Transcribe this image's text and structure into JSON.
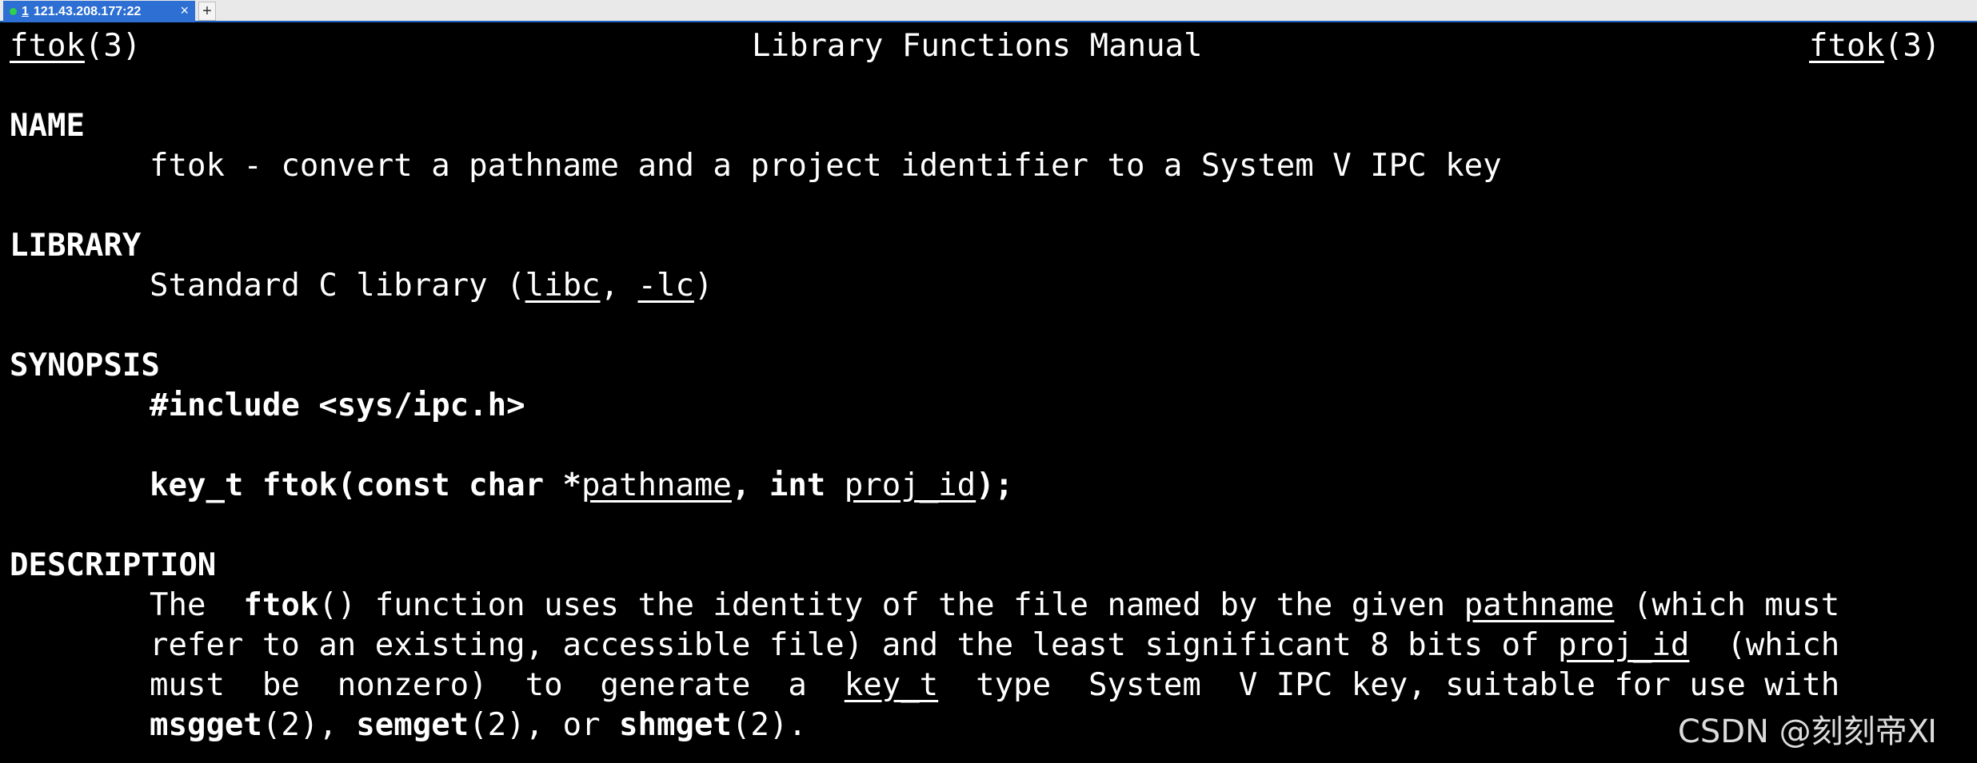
{
  "tab": {
    "number": "1",
    "title": "121.43.208.177:22",
    "close": "×",
    "new": "+"
  },
  "header": {
    "left_name": "ftok",
    "left_section": "(3)",
    "center": "Library Functions Manual",
    "right_name": "ftok",
    "right_section": "(3)"
  },
  "name_section": {
    "heading": "NAME",
    "text": "ftok - convert a pathname and a project identifier to a System V IPC key"
  },
  "library_section": {
    "heading": "LIBRARY",
    "p1": "Standard C library (",
    "libc": "libc",
    "sep": ", ",
    "lc": "-lc",
    "p2": ")"
  },
  "synopsis_section": {
    "heading": "SYNOPSIS",
    "include": "#include <sys/ipc.h>",
    "proto_a": "key_t ftok(const char *",
    "proto_pathname": "pathname",
    "proto_b": ", int ",
    "proto_projid": "proj_id",
    "proto_c": ");"
  },
  "description_section": {
    "heading": "DESCRIPTION",
    "l1_a": "The  ",
    "l1_ftok": "ftok",
    "l1_b": "() function uses the identity of the file named by the given ",
    "l1_pathname": "pathname",
    "l1_c": " (which must",
    "l2_a": "refer to an existing, accessible file) and the least significant 8 bits of ",
    "l2_projid": "proj_id",
    "l2_b": "  (which",
    "l3_a": "must  be  nonzero)  to  generate  a  ",
    "l3_keyt": "key_t",
    "l3_b": "  type  System  V IPC key, suitable for use with",
    "l4_msgget": "msgget",
    "l4_a": "(2), ",
    "l4_semget": "semget",
    "l4_b": "(2), or ",
    "l4_shmget": "shmget",
    "l4_c": "(2)."
  },
  "watermark": "CSDN @刻刻帝Ⅺ"
}
